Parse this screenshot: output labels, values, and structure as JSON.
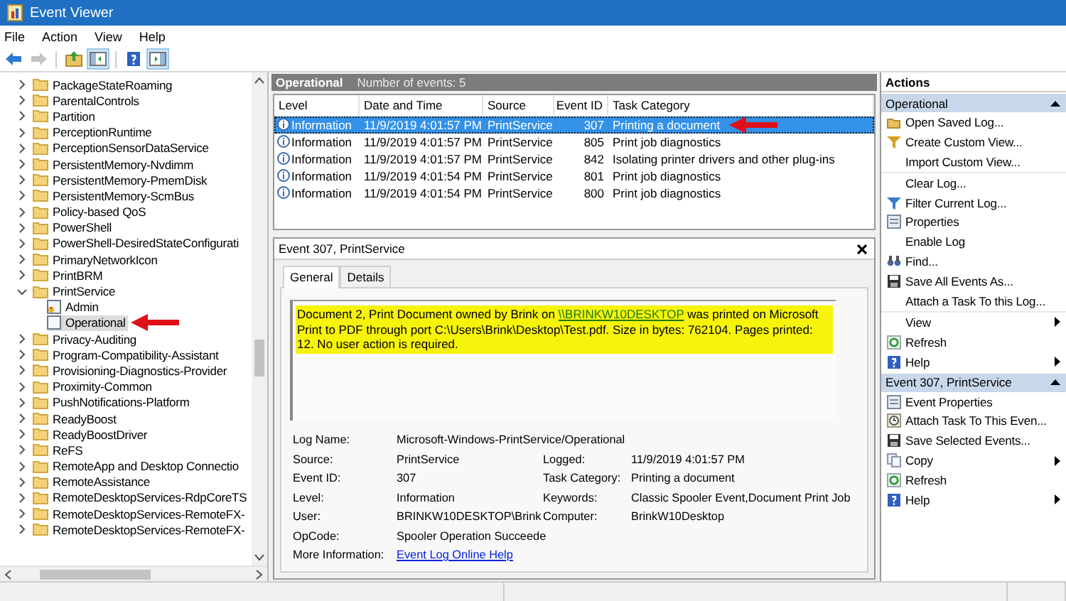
{
  "window": {
    "title": "Event Viewer"
  },
  "menu": [
    "File",
    "Action",
    "View",
    "Help"
  ],
  "toolbar": [
    {
      "kind": "back",
      "disabled": false,
      "pressed": false
    },
    {
      "kind": "forward",
      "disabled": true,
      "pressed": false
    },
    {
      "kind": "up",
      "disabled": false,
      "pressed": false
    },
    {
      "kind": "tree",
      "disabled": false,
      "pressed": true
    },
    {
      "kind": "help",
      "disabled": false,
      "pressed": false
    },
    {
      "kind": "actions",
      "disabled": false,
      "pressed": true
    }
  ],
  "tree": [
    {
      "label": "PackageStateRoaming",
      "selected": false,
      "expanded": false
    },
    {
      "label": "ParentalControls",
      "selected": false,
      "expanded": false
    },
    {
      "label": "Partition",
      "selected": false,
      "expanded": false
    },
    {
      "label": "PerceptionRuntime",
      "selected": false,
      "expanded": false
    },
    {
      "label": "PerceptionSensorDataService",
      "selected": false,
      "expanded": false
    },
    {
      "label": "PersistentMemory-Nvdimm",
      "selected": false,
      "expanded": false
    },
    {
      "label": "PersistentMemory-PmemDisk",
      "selected": false,
      "expanded": false
    },
    {
      "label": "PersistentMemory-ScmBus",
      "selected": false,
      "expanded": false
    },
    {
      "label": "Policy-based QoS",
      "selected": false,
      "expanded": false
    },
    {
      "label": "PowerShell",
      "selected": false,
      "expanded": false
    },
    {
      "label": "PowerShell-DesiredStateConfigurati",
      "selected": false,
      "expanded": false
    },
    {
      "label": "PrimaryNetworkIcon",
      "selected": false,
      "expanded": false
    },
    {
      "label": "PrintBRM",
      "selected": false,
      "expanded": false
    },
    {
      "label": "PrintService",
      "selected": false,
      "expanded": true,
      "children": [
        {
          "label": "Admin",
          "selected": false,
          "kind": "admin-log"
        },
        {
          "label": "Operational",
          "selected": true,
          "kind": "log"
        }
      ]
    },
    {
      "label": "Privacy-Auditing",
      "selected": false,
      "expanded": false
    },
    {
      "label": "Program-Compatibility-Assistant",
      "selected": false,
      "expanded": false
    },
    {
      "label": "Provisioning-Diagnostics-Provider",
      "selected": false,
      "expanded": false
    },
    {
      "label": "Proximity-Common",
      "selected": false,
      "expanded": false
    },
    {
      "label": "PushNotifications-Platform",
      "selected": false,
      "expanded": false
    },
    {
      "label": "ReadyBoost",
      "selected": false,
      "expanded": false
    },
    {
      "label": "ReadyBoostDriver",
      "selected": false,
      "expanded": false
    },
    {
      "label": "ReFS",
      "selected": false,
      "expanded": false
    },
    {
      "label": "RemoteApp and Desktop Connectio",
      "selected": false,
      "expanded": false
    },
    {
      "label": "RemoteAssistance",
      "selected": false,
      "expanded": false
    },
    {
      "label": "RemoteDesktopServices-RdpCoreTS",
      "selected": false,
      "expanded": false
    },
    {
      "label": "RemoteDesktopServices-RemoteFX-",
      "selected": false,
      "expanded": false
    },
    {
      "label": "RemoteDesktopServices-RemoteFX-",
      "selected": false,
      "expanded": false
    }
  ],
  "list": {
    "title": "Operational",
    "count": "Number of events: 5",
    "columns": [
      "Level",
      "Date and Time",
      "Source",
      "Event ID",
      "Task Category"
    ],
    "rows": [
      {
        "level": "Information",
        "date": "11/9/2019 4:01:57 PM",
        "source": "PrintService",
        "event_id": "307",
        "category": "Printing a document",
        "selected": true
      },
      {
        "level": "Information",
        "date": "11/9/2019 4:01:57 PM",
        "source": "PrintService",
        "event_id": "805",
        "category": "Print job diagnostics",
        "selected": false
      },
      {
        "level": "Information",
        "date": "11/9/2019 4:01:57 PM",
        "source": "PrintService",
        "event_id": "842",
        "category": "Isolating printer drivers and other plug-ins",
        "selected": false
      },
      {
        "level": "Information",
        "date": "11/9/2019 4:01:54 PM",
        "source": "PrintService",
        "event_id": "801",
        "category": "Print job diagnostics",
        "selected": false
      },
      {
        "level": "Information",
        "date": "11/9/2019 4:01:54 PM",
        "source": "PrintService",
        "event_id": "800",
        "category": "Print job diagnostics",
        "selected": false
      }
    ]
  },
  "detail": {
    "title": "Event 307, PrintService",
    "tabs": [
      {
        "label": "General",
        "selected": true
      },
      {
        "label": "Details",
        "selected": false
      }
    ],
    "message": {
      "before": "Document 2, Print Document owned by Brink on ",
      "link": "\\\\BRINKW10DESKTOP",
      "after": " was printed on Microsoft Print to PDF through port C:\\Users\\Brink\\Desktop\\Test.pdf.  Size in bytes: 762104. Pages printed: 12. No user action is required."
    },
    "fields": [
      [
        {
          "label": "Log Name:",
          "value": "Microsoft-Windows-PrintService/Operational"
        }
      ],
      [
        {
          "label": "Source:",
          "value": "PrintService"
        },
        {
          "label": "Logged:",
          "value": "11/9/2019 4:01:57 PM"
        }
      ],
      [
        {
          "label": "Event ID:",
          "value": "307"
        },
        {
          "label": "Task Category:",
          "value": "Printing a document"
        }
      ],
      [
        {
          "label": "Level:",
          "value": "Information"
        },
        {
          "label": "Keywords:",
          "value": "Classic Spooler Event,Document Print Job"
        }
      ],
      [
        {
          "label": "User:",
          "value": "BRINKW10DESKTOP\\Brink"
        },
        {
          "label": "Computer:",
          "value": "BrinkW10Desktop"
        }
      ],
      [
        {
          "label": "OpCode:",
          "value": "Spooler Operation Succeede"
        }
      ],
      [
        {
          "label": "More Information:",
          "value": "Event Log Online Help",
          "kind": "link"
        }
      ]
    ]
  },
  "actions": {
    "title": "Actions",
    "sections": [
      {
        "title": "Operational",
        "items": [
          {
            "label": "Open Saved Log...",
            "kind": "open",
            "submenu": false,
            "divider_above": false
          },
          {
            "label": "Create Custom View...",
            "kind": "filter-new",
            "submenu": false,
            "divider_above": false
          },
          {
            "label": "Import Custom View...",
            "kind": "none",
            "submenu": false,
            "divider_above": false
          },
          {
            "label": "Clear Log...",
            "kind": "none",
            "submenu": false,
            "divider_above": true
          },
          {
            "label": "Filter Current Log...",
            "kind": "filter",
            "submenu": false,
            "divider_above": false
          },
          {
            "label": "Properties",
            "kind": "props",
            "submenu": false,
            "divider_above": false
          },
          {
            "label": "Enable Log",
            "kind": "none",
            "submenu": false,
            "divider_above": false
          },
          {
            "label": "Find...",
            "kind": "find",
            "submenu": false,
            "divider_above": false
          },
          {
            "label": "Save All Events As...",
            "kind": "save",
            "submenu": false,
            "divider_above": false
          },
          {
            "label": "Attach a Task To this Log...",
            "kind": "none",
            "submenu": false,
            "divider_above": false
          },
          {
            "label": "View",
            "kind": "none",
            "submenu": true,
            "divider_above": true
          },
          {
            "label": "Refresh",
            "kind": "refresh",
            "submenu": false,
            "divider_above": false
          },
          {
            "label": "Help",
            "kind": "help",
            "submenu": true,
            "divider_above": false
          }
        ]
      },
      {
        "title": "Event 307, PrintService",
        "items": [
          {
            "label": "Event Properties",
            "kind": "props",
            "submenu": false,
            "divider_above": false
          },
          {
            "label": "Attach Task To This Even...",
            "kind": "task",
            "submenu": false,
            "divider_above": false
          },
          {
            "label": "Save Selected Events...",
            "kind": "save",
            "submenu": false,
            "divider_above": false
          },
          {
            "label": "Copy",
            "kind": "copy",
            "submenu": true,
            "divider_above": false
          },
          {
            "label": "Refresh",
            "kind": "refresh",
            "submenu": false,
            "divider_above": false
          },
          {
            "label": "Help",
            "kind": "help",
            "submenu": true,
            "divider_above": false
          }
        ]
      }
    ]
  }
}
